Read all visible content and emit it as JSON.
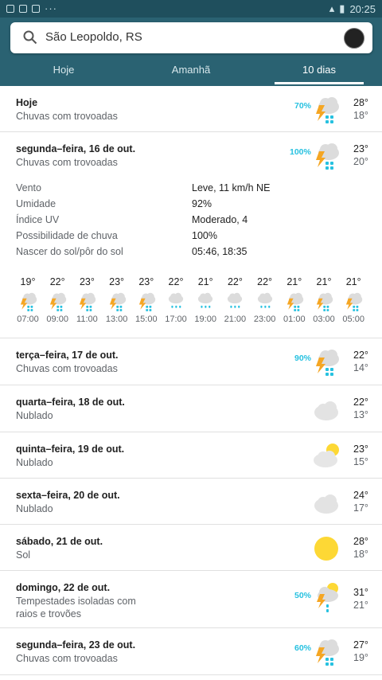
{
  "status_bar": {
    "time": "20:25",
    "dots": "···"
  },
  "search": {
    "location": "São Leopoldo, RS"
  },
  "tabs": [
    "Hoje",
    "Amanhã",
    "10 dias"
  ],
  "colors": {
    "header": "#2a6272",
    "status": "#1f4f5d",
    "precip": "#27c1e0"
  },
  "today": {
    "day": "Hoje",
    "condition": "Chuvas com trovoadas",
    "precip": "70%",
    "high": "28°",
    "low": "18°",
    "icon": "storm-icon"
  },
  "expanded": {
    "day": "segunda–feira, 16 de out.",
    "condition": "Chuvas com trovoadas",
    "precip": "100%",
    "high": "23°",
    "low": "20°",
    "icon": "storm-icon",
    "details": [
      {
        "label": "Vento",
        "value": "Leve, 11 km/h NE"
      },
      {
        "label": "Umidade",
        "value": "92%"
      },
      {
        "label": "Índice UV",
        "value": "Moderado, 4"
      },
      {
        "label": "Possibilidade de chuva",
        "value": "100%"
      },
      {
        "label": "Nascer do sol/pôr do sol",
        "value": "05:46, 18:35"
      }
    ],
    "hourly": [
      {
        "temp": "19°",
        "time": "07:00",
        "icon": "storm-icon"
      },
      {
        "temp": "22°",
        "time": "09:00",
        "icon": "storm-icon"
      },
      {
        "temp": "23°",
        "time": "11:00",
        "icon": "storm-icon"
      },
      {
        "temp": "23°",
        "time": "13:00",
        "icon": "storm-icon"
      },
      {
        "temp": "23°",
        "time": "15:00",
        "icon": "storm-icon"
      },
      {
        "temp": "22°",
        "time": "17:00",
        "icon": "rain-icon"
      },
      {
        "temp": "21°",
        "time": "19:00",
        "icon": "rain-icon"
      },
      {
        "temp": "22°",
        "time": "21:00",
        "icon": "rain-icon"
      },
      {
        "temp": "22°",
        "time": "23:00",
        "icon": "rain-icon"
      },
      {
        "temp": "21°",
        "time": "01:00",
        "icon": "storm-icon"
      },
      {
        "temp": "21°",
        "time": "03:00",
        "icon": "storm-icon"
      },
      {
        "temp": "21°",
        "time": "05:00",
        "icon": "storm-icon"
      }
    ]
  },
  "days": [
    {
      "day": "terça–feira, 17 de out.",
      "condition": "Chuvas com trovoadas",
      "precip": "90%",
      "high": "22°",
      "low": "14°",
      "icon": "storm-icon"
    },
    {
      "day": "quarta–feira, 18 de out.",
      "condition": "Nublado",
      "precip": "",
      "high": "22°",
      "low": "13°",
      "icon": "cloud-icon"
    },
    {
      "day": "quinta–feira, 19 de out.",
      "condition": "Nublado",
      "precip": "",
      "high": "23°",
      "low": "15°",
      "icon": "partly-cloudy-icon"
    },
    {
      "day": "sexta–feira, 20 de out.",
      "condition": "Nublado",
      "precip": "",
      "high": "24°",
      "low": "17°",
      "icon": "cloud-icon"
    },
    {
      "day": "sábado, 21 de out.",
      "condition": "Sol",
      "precip": "",
      "high": "28°",
      "low": "18°",
      "icon": "sun-icon"
    },
    {
      "day": "domingo, 22 de out.",
      "condition": "Tempestades isoladas com raios e trovões",
      "precip": "50%",
      "high": "31°",
      "low": "21°",
      "icon": "sun-storm-icon"
    },
    {
      "day": "segunda–feira, 23 de out.",
      "condition": "Chuvas com trovoadas",
      "precip": "60%",
      "high": "27°",
      "low": "19°",
      "icon": "storm-icon"
    }
  ]
}
